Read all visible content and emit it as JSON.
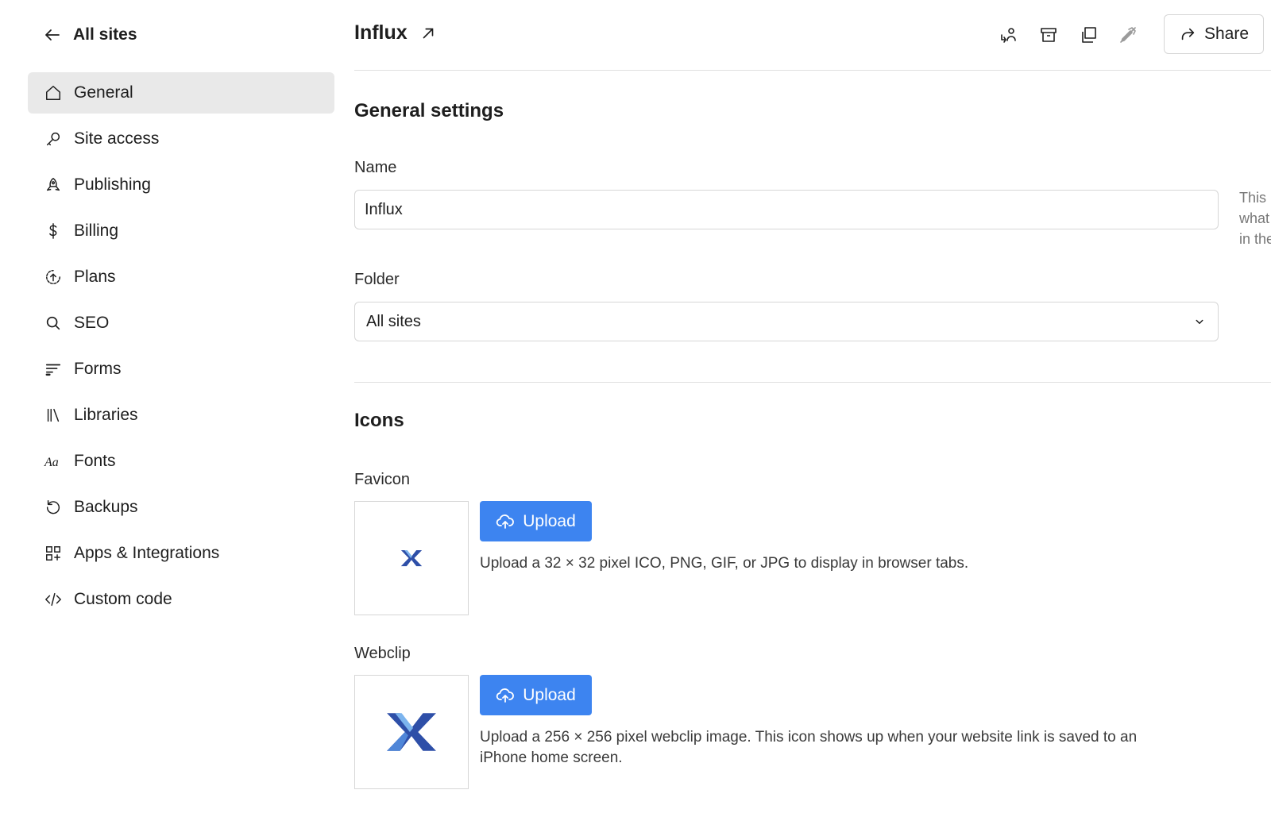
{
  "back": {
    "label": "All sites",
    "icon": "arrow-left-icon"
  },
  "sidebar": {
    "items": [
      {
        "label": "General",
        "icon": "home-icon",
        "active": true
      },
      {
        "label": "Site access",
        "icon": "key-icon"
      },
      {
        "label": "Publishing",
        "icon": "rocket-icon"
      },
      {
        "label": "Billing",
        "icon": "dollar-icon"
      },
      {
        "label": "Plans",
        "icon": "upgrade-icon"
      },
      {
        "label": "SEO",
        "icon": "search-icon"
      },
      {
        "label": "Forms",
        "icon": "form-lines-icon"
      },
      {
        "label": "Libraries",
        "icon": "library-icon"
      },
      {
        "label": "Fonts",
        "icon": "font-icon"
      },
      {
        "label": "Backups",
        "icon": "restore-icon"
      },
      {
        "label": "Apps & Integrations",
        "icon": "apps-icon"
      },
      {
        "label": "Custom code",
        "icon": "code-icon"
      }
    ]
  },
  "header": {
    "site_name": "Influx",
    "tools": [
      "transfer-user-icon",
      "archive-icon",
      "duplicate-icon",
      "edit-disabled-icon"
    ],
    "share_label": "Share"
  },
  "general": {
    "title": "General settings",
    "name_label": "Name",
    "name_value": "Influx",
    "name_note": [
      "This",
      "what",
      "in the"
    ],
    "folder_label": "Folder",
    "folder_value": "All sites"
  },
  "icons": {
    "title": "Icons",
    "favicon_label": "Favicon",
    "favicon_upload": "Upload",
    "favicon_help": "Upload a 32 × 32 pixel ICO, PNG, GIF, or JPG to display in browser tabs.",
    "webclip_label": "Webclip",
    "webclip_upload": "Upload",
    "webclip_help_1": "Upload a 256 × 256 pixel webclip image. This icon shows up when your website link is saved to an",
    "webclip_help_2": "iPhone home screen."
  },
  "colors": {
    "accent": "#3d84f0",
    "active_bg": "#e9e9e9",
    "logo_dark": "#2e4fa8",
    "logo_light": "#7cb4ee"
  }
}
